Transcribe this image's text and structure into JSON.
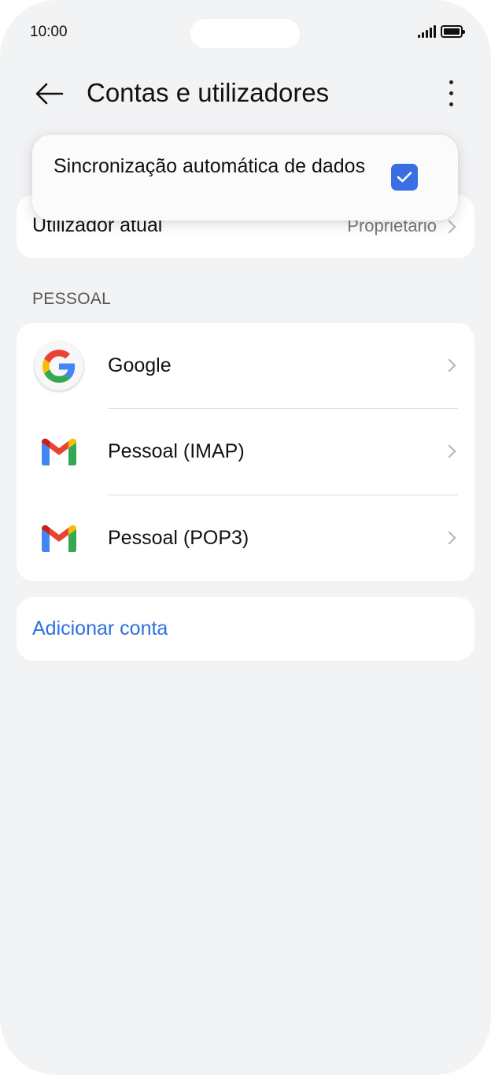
{
  "status_bar": {
    "time": "10:00"
  },
  "header": {
    "title": "Contas e utilizadores"
  },
  "popup": {
    "sync_label": "Sincronização automática de dados",
    "sync_checked": true
  },
  "current_user": {
    "label": "Utilizador atual",
    "value": "Proprietário"
  },
  "accounts_section": {
    "header": "PESSOAL",
    "items": [
      {
        "label": "Google",
        "icon": "google-icon"
      },
      {
        "label": "Pessoal (IMAP)",
        "icon": "gmail-icon"
      },
      {
        "label": "Pessoal (POP3)",
        "icon": "gmail-icon"
      }
    ]
  },
  "add_account": {
    "label": "Adicionar conta"
  },
  "colors": {
    "accent": "#3a6fe3",
    "link": "#2f6fe0",
    "background": "#f2f3f5"
  }
}
